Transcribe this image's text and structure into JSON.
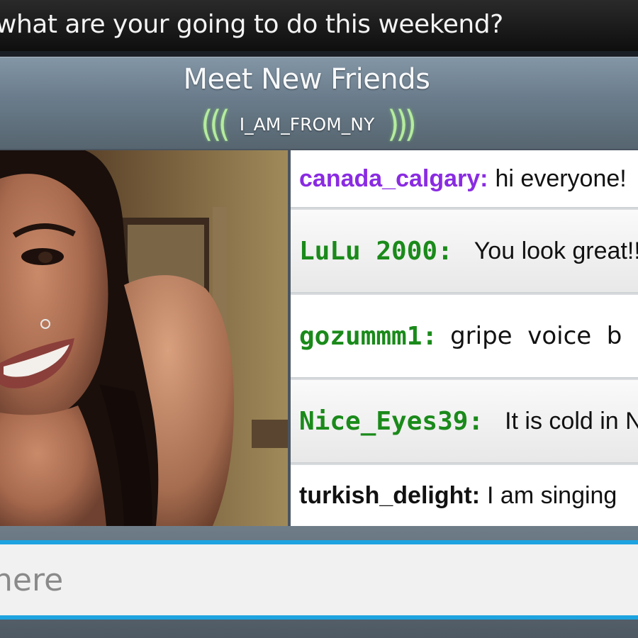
{
  "ticker": {
    "text": "what are your going to do this weekend?"
  },
  "header": {
    "title": "Meet New Friends",
    "room_name": "I_AM_FROM_NY",
    "wave_left": "(((",
    "wave_right": ")))"
  },
  "chat": {
    "messages": [
      {
        "user": "canada_calgary:",
        "text": "hi everyone!",
        "user_color": "#8a2be2"
      },
      {
        "user": "LuLu 2000:",
        "text": "You look great!!",
        "user_color": "#1a8a1a"
      },
      {
        "user": "gozummm1:",
        "text": "gripe  voice  b",
        "user_color": "#1a8a1a"
      },
      {
        "user": "Nice_Eyes39:",
        "text": "It is cold in NY",
        "user_color": "#1a8a1a"
      },
      {
        "user": "turkish_delight:",
        "text": "I am singing",
        "user_color": "#111111"
      }
    ]
  },
  "input": {
    "placeholder": "here"
  },
  "colors": {
    "accent": "#1ea3e0",
    "wave": "#b6ec9e"
  }
}
